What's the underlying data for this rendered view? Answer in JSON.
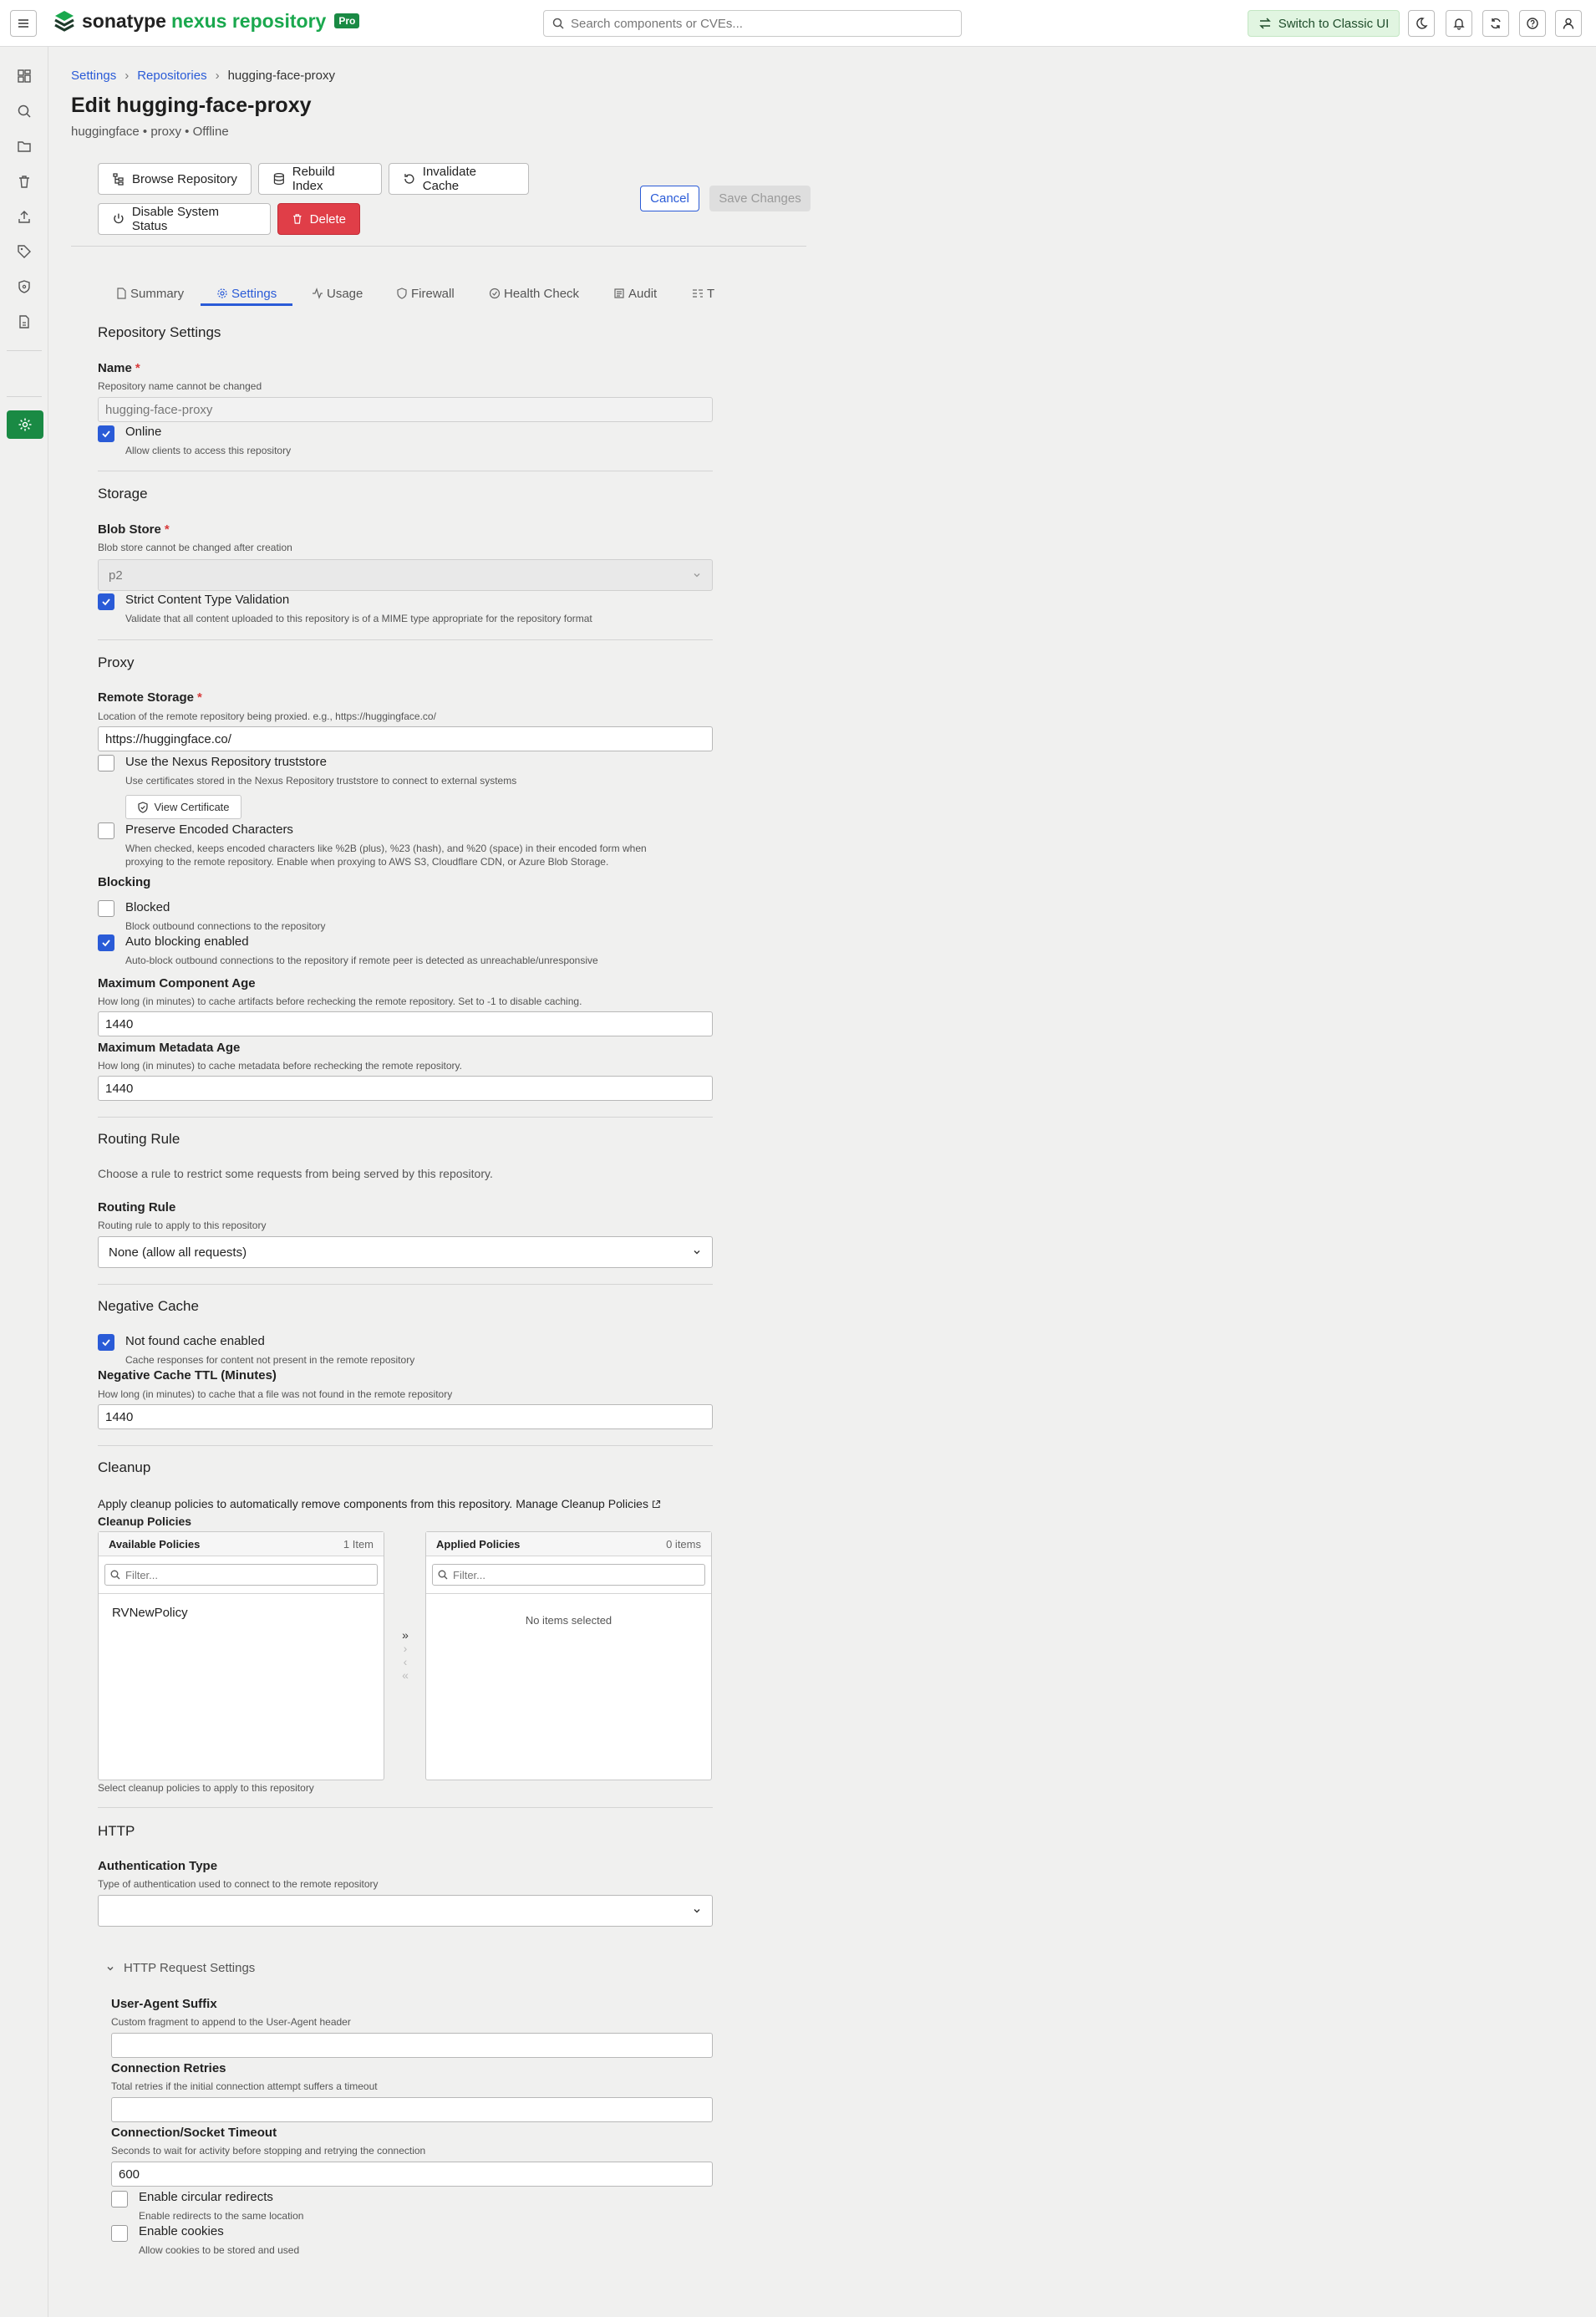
{
  "app": {
    "logo_text": "sonatype",
    "logo_product": "nexus repository",
    "badge": "Pro",
    "search_placeholder": "Search components or CVEs...",
    "switch_label": "Switch to Classic UI",
    "accent_color": "#1a8a44",
    "link_color": "#2a5bd7"
  },
  "breadcrumb": [
    "Settings",
    "Repositories",
    "hugging-face-proxy"
  ],
  "page": {
    "title": "Edit hugging-face-proxy",
    "subtitle": "huggingface • proxy • Offline"
  },
  "actions": {
    "browse": "Browse Repository",
    "rebuild": "Rebuild Index",
    "invalidate": "Invalidate Cache",
    "disable": "Disable System Status",
    "delete": "Delete",
    "cancel": "Cancel",
    "save": "Save Changes"
  },
  "tabs": [
    "Summary",
    "Settings",
    "Usage",
    "Firewall",
    "Health Check",
    "Audit",
    "T"
  ],
  "repo_settings": {
    "title": "Repository Settings",
    "name_label": "Name",
    "name_help": "Repository name cannot be changed",
    "name_value": "hugging-face-proxy",
    "online_label": "Online",
    "online_help": "Allow clients to access this repository"
  },
  "storage": {
    "title": "Storage",
    "blob_label": "Blob Store",
    "blob_help": "Blob store cannot be changed after creation",
    "blob_value": "p2",
    "strict_label": "Strict Content Type Validation",
    "strict_help": "Validate that all content uploaded to this repository is of a MIME type appropriate for the repository format"
  },
  "proxy": {
    "title": "Proxy",
    "remote_label": "Remote Storage",
    "remote_help": "Location of the remote repository being proxied. e.g., https://huggingface.co/",
    "remote_value": "https://huggingface.co/",
    "truststore_label": "Use the Nexus Repository truststore",
    "truststore_help": "Use certificates stored in the Nexus Repository truststore to connect to external systems",
    "view_cert": "View Certificate",
    "preserve_label": "Preserve Encoded Characters",
    "preserve_help_1": "When checked, keeps encoded characters like %2B (plus), %23 (hash), and %20 (space) in their encoded form when",
    "preserve_help_2": "proxying to the remote repository. Enable when proxying to AWS S3, Cloudflare CDN, or Azure Blob Storage.",
    "blocking_title": "Blocking",
    "blocked_label": "Blocked",
    "blocked_help": "Block outbound connections to the repository",
    "auto_label": "Auto blocking enabled",
    "auto_help": "Auto-block outbound connections to the repository if remote peer is detected as unreachable/unresponsive",
    "max_comp_label": "Maximum Component Age",
    "max_comp_help": "How long (in minutes) to cache artifacts before rechecking the remote repository. Set to -1 to disable caching.",
    "max_comp_value": "1440",
    "max_meta_label": "Maximum Metadata Age",
    "max_meta_help": "How long (in minutes) to cache metadata before rechecking the remote repository.",
    "max_meta_value": "1440"
  },
  "routing": {
    "title": "Routing Rule",
    "desc": "Choose a rule to restrict some requests from being served by this repository.",
    "label": "Routing Rule",
    "help": "Routing rule to apply to this repository",
    "value": "None (allow all requests)"
  },
  "negative_cache": {
    "title": "Negative Cache",
    "nf_label": "Not found cache enabled",
    "nf_help": "Cache responses for content not present in the remote repository",
    "ttl_label": "Negative Cache TTL (Minutes)",
    "ttl_help": "How long (in minutes) to cache that a file was not found in the remote repository",
    "ttl_value": "1440"
  },
  "cleanup": {
    "title": "Cleanup",
    "desc": "Apply cleanup policies to automatically remove components from this repository.",
    "manage_link": "Manage Cleanup Policies",
    "label": "Cleanup Policies",
    "available_title": "Available Policies",
    "available_count": "1 Item",
    "applied_title": "Applied Policies",
    "applied_count": "0 items",
    "filter_placeholder": "Filter...",
    "available_items": [
      "RVNewPolicy"
    ],
    "empty_text": "No items selected",
    "help": "Select cleanup policies to apply to this repository"
  },
  "http": {
    "title": "HTTP",
    "auth_label": "Authentication Type",
    "auth_help": "Type of authentication used to connect to the remote repository",
    "auth_value": "",
    "request_settings": "HTTP Request Settings",
    "ua_label": "User-Agent Suffix",
    "ua_help": "Custom fragment to append to the User-Agent header",
    "ua_value": "",
    "retries_label": "Connection Retries",
    "retries_help": "Total retries if the initial connection attempt suffers a timeout",
    "retries_value": "",
    "timeout_label": "Connection/Socket Timeout",
    "timeout_help": "Seconds to wait for activity before stopping and retrying the connection",
    "timeout_value": "600",
    "circular_label": "Enable circular redirects",
    "circular_help": "Enable redirects to the same location",
    "cookies_label": "Enable cookies",
    "cookies_help": "Allow cookies to be stored and used"
  }
}
